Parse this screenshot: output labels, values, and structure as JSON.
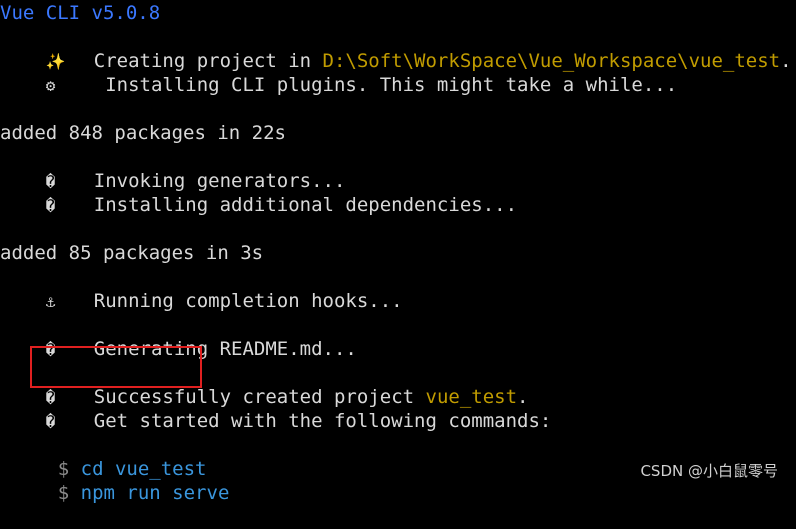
{
  "terminal": {
    "header": "Vue CLI v5.0.8",
    "line_creating": {
      "icon": "✨",
      "text": "Creating project in ",
      "path": "D:\\Soft\\WorkSpace\\Vue_Workspace\\vue_test",
      "suffix": "."
    },
    "line_installing_plugins": {
      "icon": "⚙",
      "text": " Installing CLI plugins. This might take a while..."
    },
    "line_added_848": "added 848 packages in 22s",
    "line_invoking": {
      "icon": "�",
      "text": "Invoking generators..."
    },
    "line_installing_deps": {
      "icon": "�",
      "text": "Installing additional dependencies..."
    },
    "line_added_85": "added 85 packages in 3s",
    "line_hooks": {
      "icon": "⚓",
      "text": "Running completion hooks..."
    },
    "line_readme": {
      "icon": "�",
      "text": "Generating README.md..."
    },
    "line_success": {
      "icon": "�",
      "text_a": "Successfully",
      "text_b": " created project ",
      "project": "vue_test",
      "suffix": "."
    },
    "line_get_started": {
      "icon": "�",
      "text": "Get started with the following commands:"
    },
    "commands": [
      {
        "prompt": "$",
        "command": "cd vue_test"
      },
      {
        "prompt": "$",
        "command": "npm run serve"
      }
    ]
  },
  "watermark": "CSDN @小白鼠零号",
  "colors": {
    "background": "#000000",
    "text": "#d9d9d9",
    "header_blue": "#3b78ff",
    "path_yellow": "#c19c00",
    "command_blue": "#3a96dd",
    "highlight_red": "#e02020"
  },
  "icons": {
    "creating": "sparkles-icon",
    "installing_plugins": "gear-icon",
    "invoking": "unknown-glyph-icon",
    "installing_deps": "unknown-glyph-icon",
    "hooks": "anchor-icon",
    "readme": "unknown-glyph-icon",
    "success": "unknown-glyph-icon",
    "get_started": "unknown-glyph-icon"
  }
}
